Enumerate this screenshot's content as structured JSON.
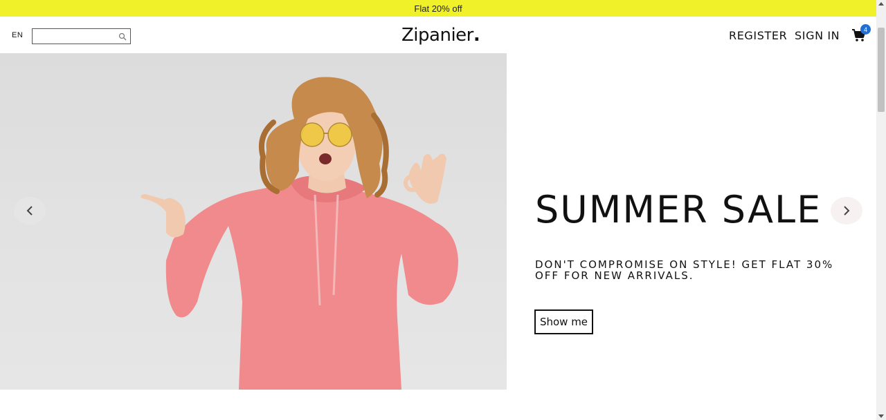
{
  "announcement": {
    "text": "Flat 20% off"
  },
  "header": {
    "language": "EN",
    "search": {
      "value": "",
      "placeholder": ""
    },
    "logo": "Zipanier",
    "logo_dot": ".",
    "nav": {
      "register": "REGISTER",
      "signin": "SIGN IN"
    },
    "cart": {
      "count": "4"
    }
  },
  "hero": {
    "title": "SUMMER SALE",
    "subtitle": "DON'T COMPROMISE ON STYLE! GET FLAT 30% OFF FOR NEW ARRIVALS.",
    "cta": "Show me"
  },
  "icons": {
    "search": "search-icon",
    "cart": "cart-icon",
    "prev": "chevron-left-icon",
    "next": "chevron-right-icon"
  },
  "colors": {
    "announcement_bg": "#f1f12a",
    "badge": "#1f6fd6",
    "hoodie": "#f08a8c"
  }
}
